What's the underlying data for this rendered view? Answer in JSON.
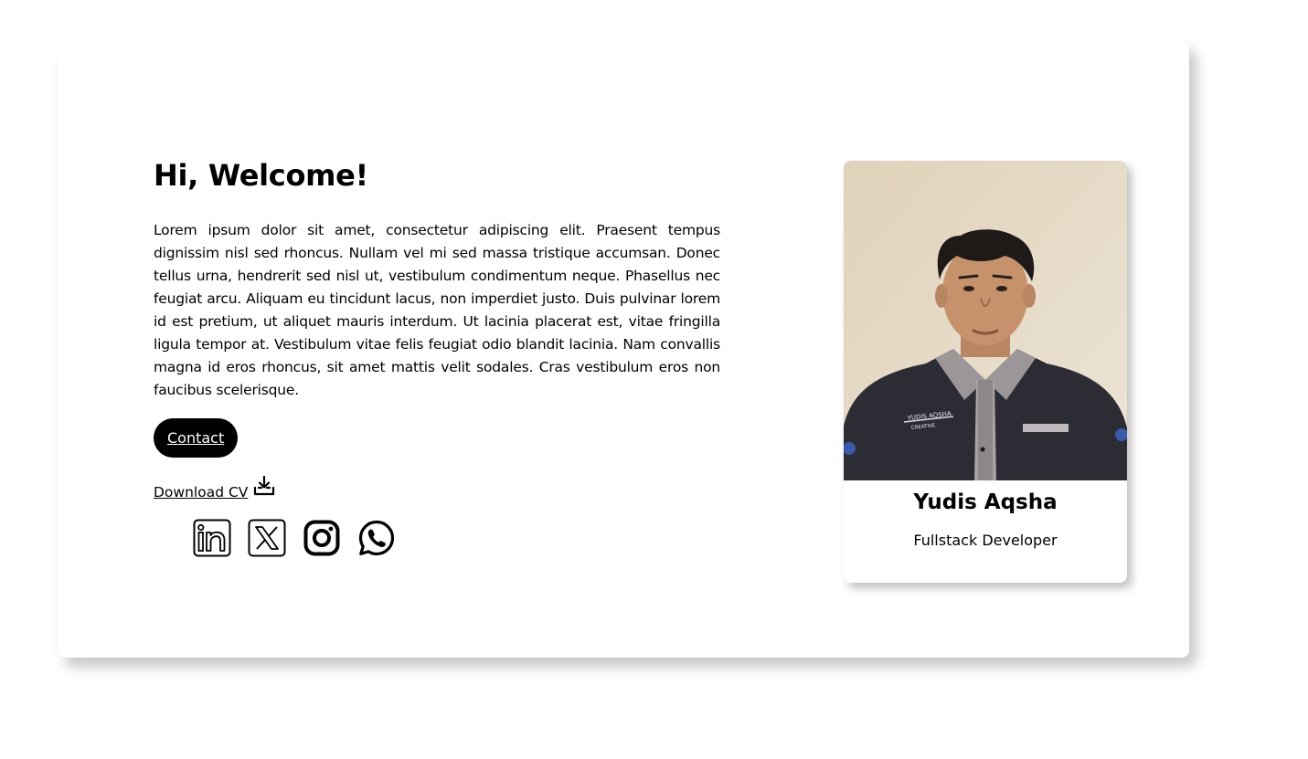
{
  "hero": {
    "title": "Hi, Welcome!",
    "bio": "Lorem ipsum dolor sit amet, consectetur adipiscing elit. Praesent tempus dignissim nisl sed rhoncus. Nullam vel mi sed massa tristique accumsan. Donec tellus urna, hendrerit sed nisl ut, vestibulum condimentum neque. Phasellus nec feugiat arcu. Aliquam eu tincidunt lacus, non imperdiet justo. Duis pulvinar lorem id est pretium, ut aliquet mauris interdum. Ut lacinia placerat est, vitae fringilla ligula tempor at. Vestibulum vitae felis feugiat odio blandit lacinia. Nam convallis magna id eros rhoncus, sit amet mattis velit sodales. Cras vestibulum eros non faucibus scelerisque.",
    "contact_label": "Contact",
    "download_label": "Download CV"
  },
  "socials": [
    {
      "icon": "linkedin-icon"
    },
    {
      "icon": "x-twitter-icon"
    },
    {
      "icon": "instagram-icon"
    },
    {
      "icon": "whatsapp-icon"
    }
  ],
  "profile": {
    "name": "Yudis Aqsha",
    "role": "Fullstack Developer",
    "shirt_text": "YUDIS AQSHA",
    "shirt_subtext": "CREATIVE"
  },
  "colors": {
    "primary": "#000000",
    "background": "#ffffff",
    "photo_wall": "#e4d8c5"
  }
}
